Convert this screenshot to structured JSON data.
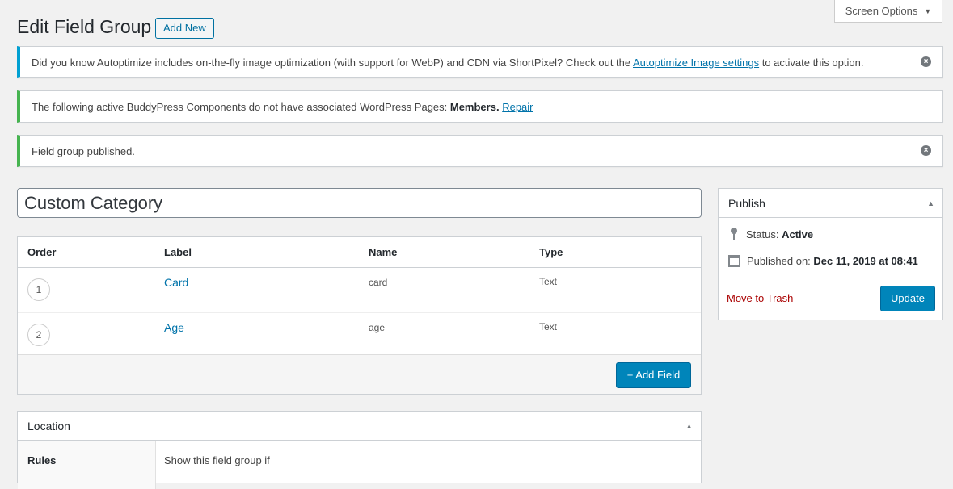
{
  "header": {
    "screen_options": "Screen Options",
    "title": "Edit Field Group",
    "add_new": "Add New"
  },
  "notices": {
    "autoptimize": {
      "text_before": "Did you know Autoptimize includes on-the-fly image optimization (with support for WebP) and CDN via ShortPixel? Check out the ",
      "link": "Autoptimize Image settings",
      "text_after": " to activate this option."
    },
    "buddypress": {
      "text_before": "The following active BuddyPress Components do not have associated WordPress Pages: ",
      "bold": "Members.",
      "link": "Repair"
    },
    "published": {
      "text": "Field group published."
    }
  },
  "field_group_title": "Custom Category",
  "fields": {
    "columns": [
      "Order",
      "Label",
      "Name",
      "Type"
    ],
    "rows": [
      {
        "order": "1",
        "label": "Card",
        "name": "card",
        "type": "Text"
      },
      {
        "order": "2",
        "label": "Age",
        "name": "age",
        "type": "Text"
      }
    ],
    "add_field": "+ Add Field"
  },
  "publish": {
    "title": "Publish",
    "status_label": "Status:",
    "status_value": "Active",
    "published_label": "Published on:",
    "published_value": "Dec 11, 2019 at 08:41",
    "trash": "Move to Trash",
    "update": "Update"
  },
  "location": {
    "title": "Location",
    "rules_label": "Rules",
    "show_if": "Show this field group if"
  },
  "colors": {
    "primary": "#0085ba",
    "link": "#0073aa",
    "info_border": "#00a0d2",
    "success_border": "#46b450",
    "trash": "#a00"
  }
}
